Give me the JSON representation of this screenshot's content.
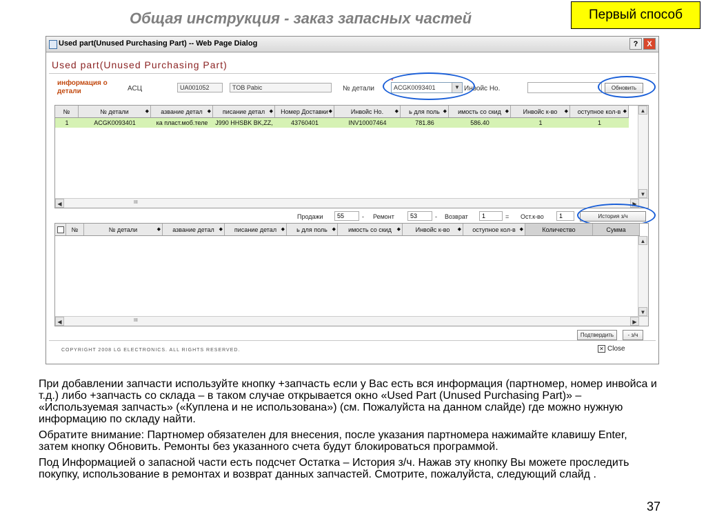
{
  "slide": {
    "title": "Общая инструкция - заказ запасных частей",
    "badge": "Первый способ",
    "page_number": "37",
    "paragraphs": [
      "При добавлении запчасти используйте кнопку +запчасть если у Вас есть вся информация (партномер, номер инвойса и т.д.) либо +запчасть со склада – в таком случае открывается окно «Used Part (Unused Purchasing Part)» – «Используемая запчасть» («Куплена и не использована») (см. Пожалуйста на данном слайде) где можно нужную информацию по складу найти.",
      "Обратите внимание: Партномер обязателен для внесения, после указания партномера нажимайте клавишу Enter, затем кнопку Обновить. Ремонты без указанного счета будут блокироваться программой.",
      "Под Информацией о запасной части есть подсчет Остатка – История з/ч. Нажав эту кнопку Вы можете проследить покупку, использование в ремонтах и возврат данных запчастей. Смотрите, пожалуйста, следующий слайд ."
    ]
  },
  "dialog": {
    "window_title": "Used part(Unused Purchasing Part) -- Web Page Dialog",
    "help_label": "?",
    "close_label": "X",
    "heading": "Used part(Unused Purchasing Part)",
    "info_label_1": "информация о",
    "info_label_2": "детали",
    "asc_label": "АСЦ",
    "asc_code": "UA001052",
    "asc_name": "TOB Pabic",
    "part_no_label": "№ детали",
    "required_mark": "*",
    "part_no_value": "ACGK0093401",
    "invoice_label": "Инвойс Но.",
    "invoice_value": "",
    "refresh_label": "Обновить",
    "grid1": {
      "headers": [
        "№",
        "№ детали",
        "азвание детал",
        "писание детал",
        "Номер Доставки",
        "Инвойс Но.",
        "ь для поль",
        "имость со скид",
        "Инвойс к-во",
        "оступное кол-в"
      ],
      "rows": [
        [
          "1",
          "ACGK0093401",
          "ка пласт.моб.теле",
          "J990 HHSBK BK,ZZ,",
          "43760401",
          "INV10007464",
          "781.86",
          "586.40",
          "1",
          "1"
        ]
      ],
      "scroll_mark": "III"
    },
    "stats": {
      "sales_label": "Продажи",
      "sales_value": "55",
      "repair_label": "Ремонт",
      "repair_value": "53",
      "return_label": "Возврат",
      "return_value": "1",
      "balance_label": "Ост.к-во",
      "balance_value": "1",
      "minus1": "-",
      "minus2": "-",
      "equals": "=",
      "history_label": "История з/ч"
    },
    "grid2": {
      "headers": [
        "№",
        "№ детали",
        "азвание детал",
        "писание детал",
        "ь для поль",
        "имость со скид",
        "Инвойс к-во",
        "оступное кол-в",
        "Количество",
        "Сумма"
      ],
      "scroll_mark": "III"
    },
    "confirm_label": "Подтвердить",
    "minus_part_label": "- з/ч",
    "copyright": "COPYRIGHT 2008 LG ELECTRONICS. ALL RIGHTS RESERVED.",
    "close_text": "Close"
  }
}
